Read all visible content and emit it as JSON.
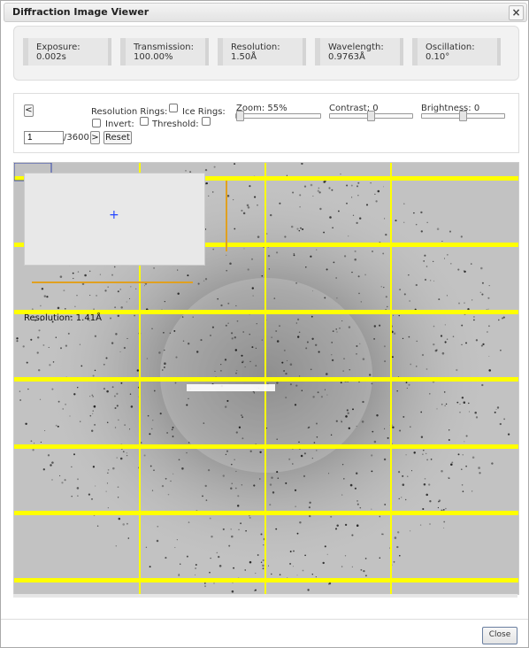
{
  "window": {
    "title": "Diffraction Image Viewer",
    "close_glyph": "×"
  },
  "stats": [
    {
      "label": "Exposure:",
      "value": "0.002s"
    },
    {
      "label": "Transmission:",
      "value": "100.00%"
    },
    {
      "label": "Resolution:",
      "value": "1.50Å"
    },
    {
      "label": "Wavelength:",
      "value": "0.9763Å"
    },
    {
      "label": "Oscillation:",
      "value": "0.10°"
    }
  ],
  "controls": {
    "prev_label": "<",
    "next_label": ">",
    "reset_label": "Reset",
    "resolution_rings_label": "Resolution Rings:",
    "ice_rings_label": "Ice Rings:",
    "invert_label": "Invert:",
    "threshold_label": "Threshold:",
    "zoom_label": "Zoom: 55%",
    "contrast_label": "Contrast: 0",
    "brightness_label": "Brightness: 0",
    "frame_value": "1",
    "frame_total": "/3600",
    "zoom_level": 0.55,
    "contrast_level": 0.5,
    "brightness_level": 0.5
  },
  "viewer": {
    "resolution_overlay": "Resolution: 1.41Å",
    "grid_color": "#ffff00",
    "inset_marker": "+"
  },
  "footer": {
    "close_label": "Close"
  }
}
